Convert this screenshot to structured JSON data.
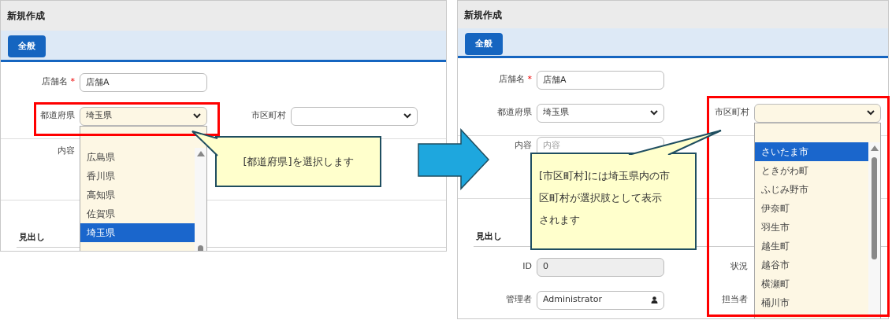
{
  "panels": [
    {
      "title": "新規作成",
      "tabs": [
        {
          "label": "全般",
          "selected": true
        }
      ],
      "fields": [
        {
          "label": "店舗名",
          "marker": "*",
          "value": "店舗A"
        },
        {
          "label": "都道府県",
          "value": "埼玉県",
          "options": [
            {
              "label": "広島県",
              "selected": false
            },
            {
              "label": "香川県",
              "selected": false
            },
            {
              "label": "高知県",
              "selected": false
            },
            {
              "label": "佐賀県",
              "selected": false
            },
            {
              "label": "埼玉県",
              "selected": true
            }
          ]
        },
        {
          "label": "市区町村"
        },
        {
          "label": "内容"
        }
      ],
      "section": "見出し"
    },
    {
      "title": "新規作成",
      "tabs": [
        {
          "label": "全般",
          "selected": true
        }
      ],
      "fields": [
        {
          "label": "店舗名",
          "marker": "*",
          "value": "店舗A"
        },
        {
          "label": "都道府県",
          "value": "埼玉県"
        },
        {
          "label": "市区町村",
          "options": [
            {
              "label": "さいたま市",
              "selected": true
            },
            {
              "label": "ときがわ町",
              "selected": false
            },
            {
              "label": "ふじみ野市",
              "selected": false
            },
            {
              "label": "伊奈町",
              "selected": false
            },
            {
              "label": "羽生市",
              "selected": false
            },
            {
              "label": "越生町",
              "selected": false
            },
            {
              "label": "越谷市",
              "selected": false
            },
            {
              "label": "横瀬町",
              "selected": false
            },
            {
              "label": "桶川市",
              "selected": false
            }
          ]
        },
        {
          "label": "内容",
          "placeholder": "内容"
        }
      ],
      "section": "見出し",
      "details": [
        {
          "label": "ID",
          "value": "0",
          "disabled": true
        },
        {
          "label": "状況"
        },
        {
          "label": "管理者",
          "value": "Administrator",
          "kind": "user"
        },
        {
          "label": "担当者"
        }
      ]
    }
  ],
  "callouts": [
    {
      "text": "[都道府県]を選択します"
    },
    {
      "text": "[市区町村]には埼玉県内の市区町村が選択肢として表示されます"
    }
  ]
}
